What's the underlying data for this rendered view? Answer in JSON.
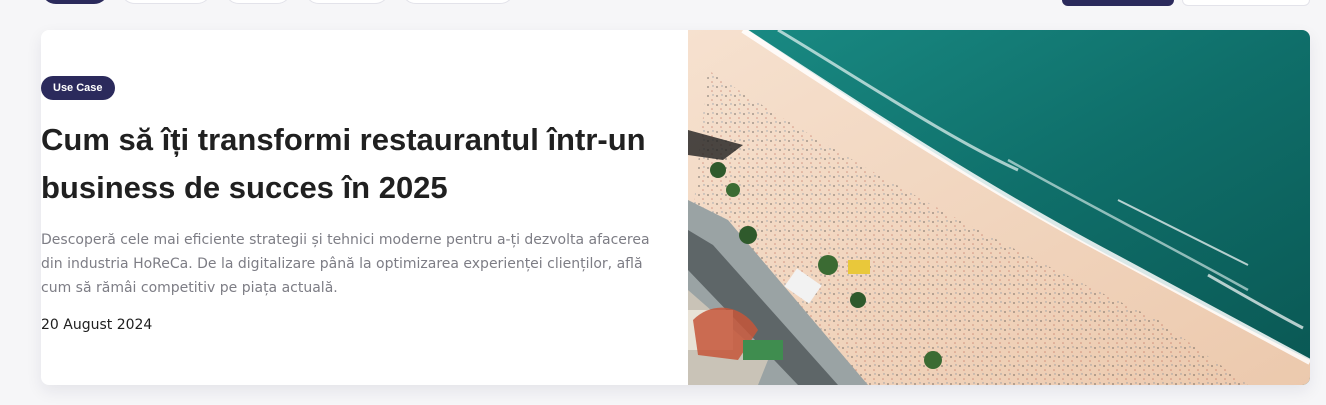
{
  "filters": {
    "chips": [
      "",
      "",
      "",
      "",
      ""
    ],
    "buttons": [
      "",
      ""
    ]
  },
  "article": {
    "badge": "Use Case",
    "title": "Cum să îți transformi restaurantul într-un business de succes în 2025",
    "description": "Descoperă cele mai eficiente strategii și tehnici moderne pentru a-ți dezvolta afacerea din industria HoReCa. De la digitalizare până la optimizarea experienței clienților, află cum să rămâi competitiv pe piața actuală.",
    "date": "20 August 2024",
    "image": "aerial-beach-photo"
  },
  "colors": {
    "brand": "#2b2a5c",
    "title": "#202020",
    "body_text": "#7d7d85",
    "sea": "#0f6f6a",
    "sand": "#f2d9c4"
  }
}
